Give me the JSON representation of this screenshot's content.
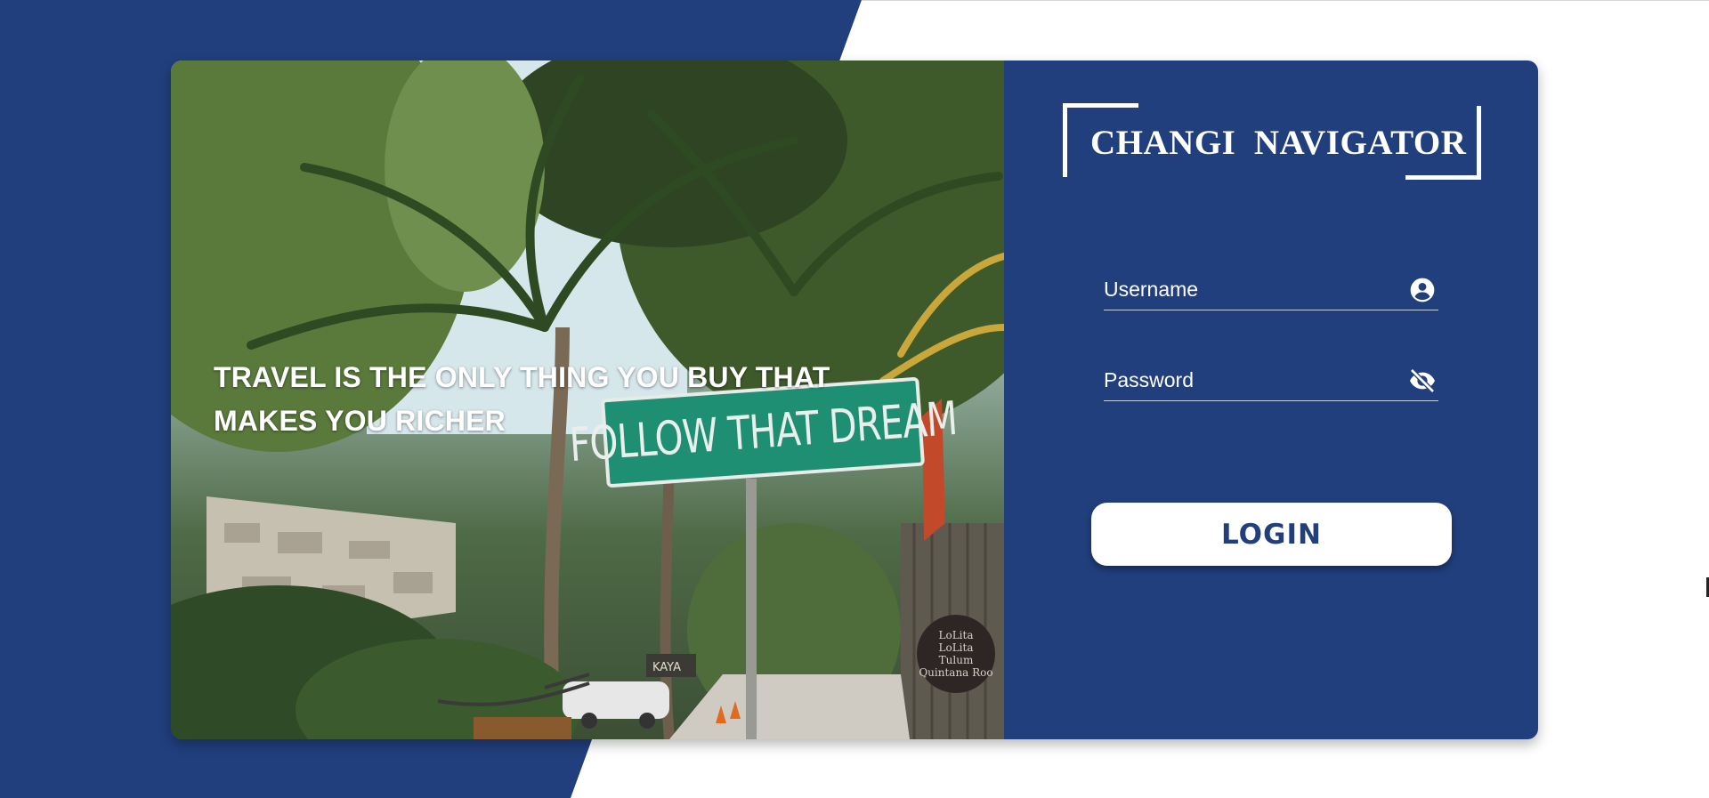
{
  "app": {
    "brand_title": "CHANGI  NAVIGATOR"
  },
  "hero": {
    "quote": "TRAVEL IS THE ONLY THING YOU BUY THAT MAKES YOU RICHER",
    "street_sign_text": "FOLLOW THAT DREAM",
    "round_sign_text": "LoLita\nLoLita\nTulum\nQuintana Roo",
    "shop_sign_text": "KAYA"
  },
  "form": {
    "username_label": "Username",
    "password_label": "Password",
    "login_label": "LOGIN",
    "username_icon": "account-circle-icon",
    "password_icon": "visibility-off-icon"
  },
  "colors": {
    "primary": "#213f7d",
    "surface": "#ffffff"
  }
}
